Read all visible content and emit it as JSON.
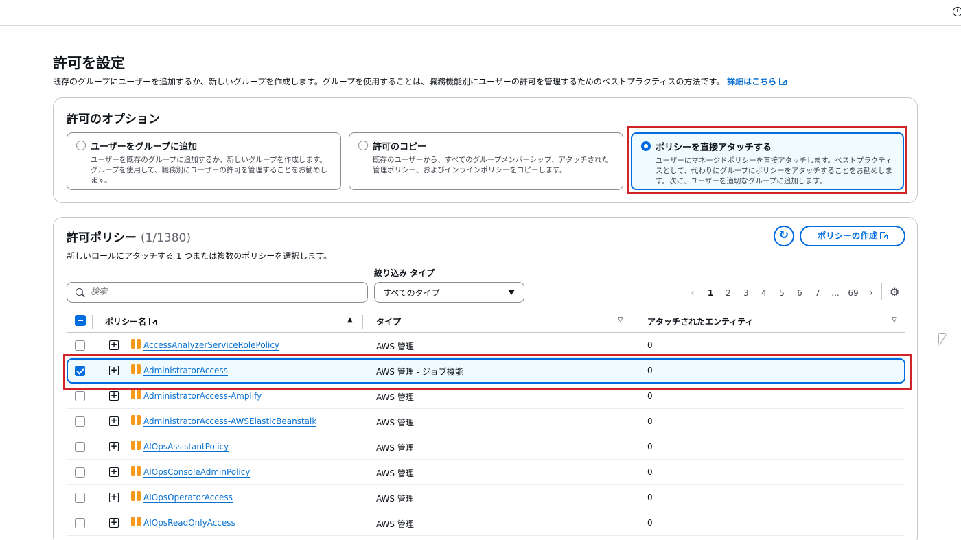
{
  "page": {
    "title": "許可を設定",
    "description": "既存のグループにユーザーを追加するか、新しいグループを作成します。グループを使用することは、職務機能別にユーザーの許可を管理するためのベストプラクティスの方法です。",
    "learn_more": "詳細はこちら"
  },
  "options": {
    "title": "許可のオプション",
    "items": [
      {
        "label": "ユーザーをグループに追加",
        "desc": "ユーザーを既存のグループに追加するか、新しいグループを作成します。グループを使用して、職務別にユーザーの許可を管理することをお勧めします。",
        "selected": false
      },
      {
        "label": "許可のコピー",
        "desc": "既存のユーザーから、すべてのグループメンバーシップ、アタッチされた管理ポリシー、およびインラインポリシーをコピーします。",
        "selected": false
      },
      {
        "label": "ポリシーを直接アタッチする",
        "desc": "ユーザーにマネージドポリシーを直接アタッチします。ベストプラクティスとして、代わりにグループにポリシーをアタッチすることをお勧めします。次に、ユーザーを適切なグループに追加します。",
        "selected": true
      }
    ]
  },
  "policies": {
    "title": "許可ポリシー",
    "count": "(1/1380)",
    "subtitle": "新しいロールにアタッチする 1 つまたは複数のポリシーを選択します。",
    "create_button": "ポリシーの作成",
    "filter_label": "絞り込み タイプ",
    "search_placeholder": "検索",
    "filter_value": "すべてのタイプ",
    "pagination": {
      "pages": [
        "1",
        "2",
        "3",
        "4",
        "5",
        "6",
        "7",
        "...",
        "69"
      ],
      "current": "1"
    },
    "columns": {
      "name": "ポリシー名",
      "type": "タイプ",
      "entities": "アタッチされたエンティティ"
    },
    "rows": [
      {
        "name": "AccessAnalyzerServiceRolePolicy",
        "type": "AWS 管理",
        "entities": "0",
        "checked": false
      },
      {
        "name": "AdministratorAccess",
        "type": "AWS 管理 - ジョブ機能",
        "entities": "0",
        "checked": true
      },
      {
        "name": "AdministratorAccess-Amplify",
        "type": "AWS 管理",
        "entities": "0",
        "checked": false
      },
      {
        "name": "AdministratorAccess-AWSElasticBeanstalk",
        "type": "AWS 管理",
        "entities": "0",
        "checked": false
      },
      {
        "name": "AIOpsAssistantPolicy",
        "type": "AWS 管理",
        "entities": "0",
        "checked": false
      },
      {
        "name": "AIOpsConsoleAdminPolicy",
        "type": "AWS 管理",
        "entities": "0",
        "checked": false
      },
      {
        "name": "AIOpsOperatorAccess",
        "type": "AWS 管理",
        "entities": "0",
        "checked": false
      },
      {
        "name": "AIOpsReadOnlyAccess",
        "type": "AWS 管理",
        "entities": "0",
        "checked": false
      }
    ]
  },
  "colors": {
    "accent": "#006ce0",
    "link": "#0972d3",
    "highlight": "#d2232a",
    "selected_bg": "#f0fbff"
  }
}
